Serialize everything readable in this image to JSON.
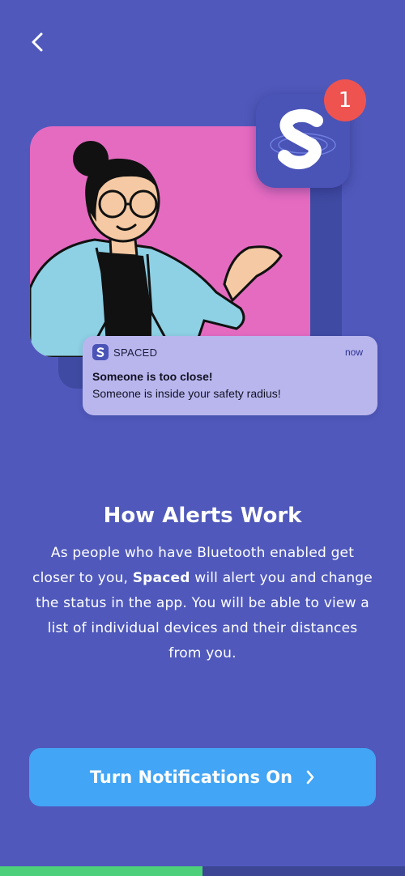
{
  "nav": {
    "back_icon": "chevron-left-icon"
  },
  "hero": {
    "app_icon": "spaced-logo-icon",
    "badge_count": "1",
    "illustration": "woman-with-glasses-waving"
  },
  "notification": {
    "app_name": "SPACED",
    "time": "now",
    "title": "Someone is too close!",
    "body": "Someone is inside your safety radius!"
  },
  "content": {
    "title": "How Alerts Work",
    "description_before": "As people who have Bluetooth enabled get closer to you, ",
    "description_bold": "Spaced",
    "description_after": " will alert you and change the status in the app. You will be able to view a list of individual devices and their distances from you."
  },
  "cta": {
    "label": "Turn Notifications On",
    "icon": "chevron-right-icon"
  },
  "progress": {
    "value": 0.5
  },
  "colors": {
    "background": "#5059bb",
    "card": "#e56bc1",
    "cta": "#42a5f5",
    "badge": "#ef5350",
    "progress": "#4cd07a"
  }
}
